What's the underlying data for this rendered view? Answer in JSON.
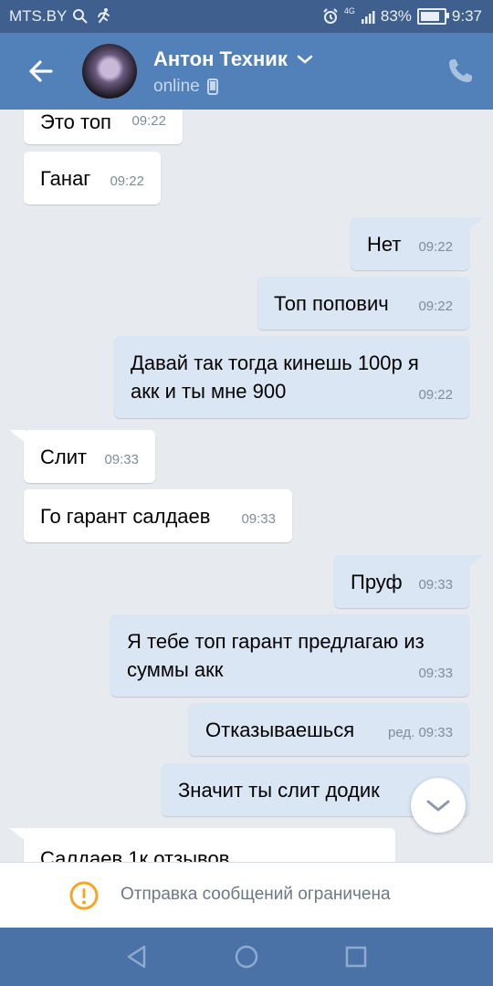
{
  "status_bar": {
    "carrier": "MTS.BY",
    "network": "4G",
    "battery_percent": "83%",
    "battery_level": 0.83,
    "time": "9:37"
  },
  "header": {
    "contact_name": "Антон Техник",
    "contact_status": "online"
  },
  "messages": [
    {
      "direction": "in",
      "text": "Это топ",
      "time": "09:22"
    },
    {
      "direction": "in",
      "text": "Ганаг",
      "time": "09:22"
    },
    {
      "direction": "out",
      "text": "Нет",
      "time": "09:22"
    },
    {
      "direction": "out",
      "text": "Топ попович",
      "time": "09:22"
    },
    {
      "direction": "out",
      "text_lines": [
        "Давай так тогда кинешь 100р я",
        "акк и ты мне 900"
      ],
      "time": "09:22"
    },
    {
      "direction": "in",
      "text": "Слит",
      "time": "09:33"
    },
    {
      "direction": "in",
      "text": "Го гарант салдаев",
      "time": "09:33"
    },
    {
      "direction": "out",
      "text": "Пруф",
      "time": "09:33"
    },
    {
      "direction": "out",
      "text_lines": [
        "Я тебе топ гарант предлагаю из",
        "суммы акк"
      ],
      "time": "09:33"
    },
    {
      "direction": "out",
      "text": "Отказываешься",
      "time": "ред. 09:33"
    },
    {
      "direction": "out",
      "text": "Значит ты слит додик",
      "time": ""
    },
    {
      "direction": "in",
      "text": "Салдаев 1к отзывов",
      "time": ""
    }
  ],
  "composer": {
    "restriction_text": "Отправка сообщений ограничена"
  },
  "colors": {
    "header": "#5181b8",
    "status_bar": "#3f608e",
    "incoming_bubble": "#ffffff",
    "outgoing_bubble": "#dae6f4",
    "chat_background": "#e7ebf0",
    "warning": "#f5a623",
    "nav_bar": "#4b72a6"
  }
}
